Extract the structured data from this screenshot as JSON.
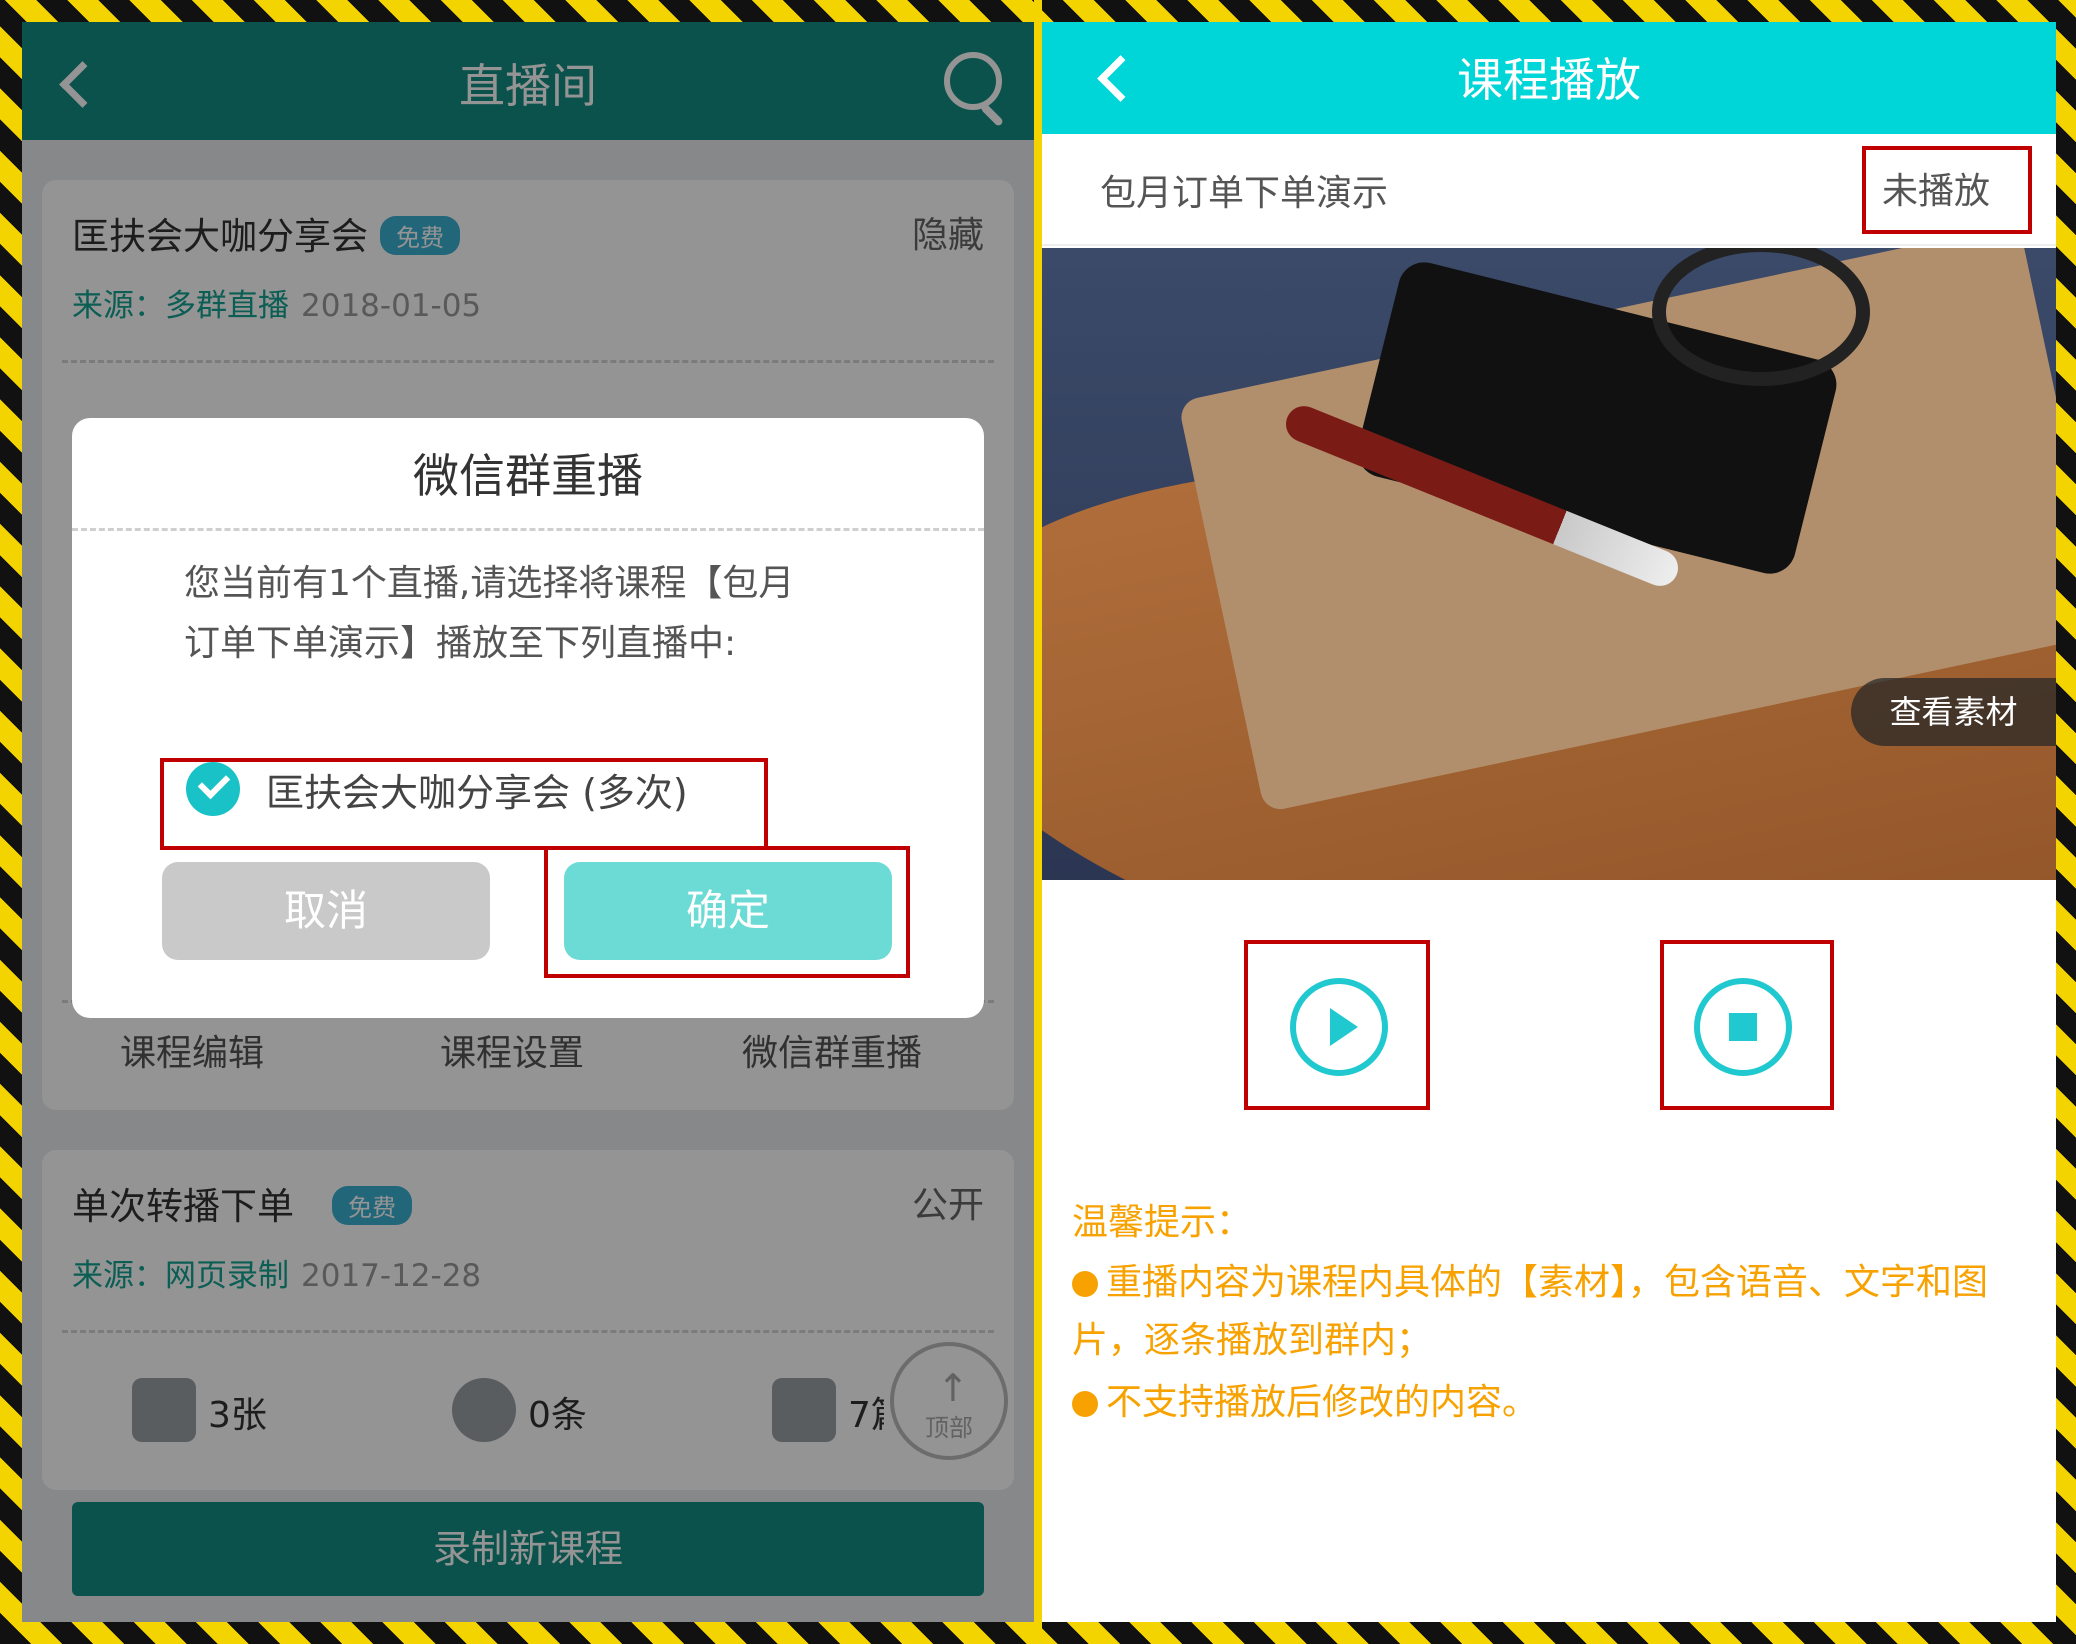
{
  "left": {
    "header": {
      "title": "直播间"
    },
    "card1": {
      "title": "匡扶会大咖分享会",
      "badge": "免费",
      "status": "隐藏",
      "source": "来源：多群直播",
      "date": "2018-01-05",
      "actions": [
        "课程编辑",
        "课程设置",
        "微信群重播"
      ]
    },
    "card2": {
      "title": "单次转播下单",
      "badge": "免费",
      "status": "公开",
      "source": "来源：网页录制",
      "date": "2017-12-28",
      "stats": [
        "3张",
        "0条",
        "7篇"
      ]
    },
    "to_top": "顶部",
    "record_button": "录制新课程",
    "dialog": {
      "title": "微信群重播",
      "message": "您当前有1个直播,请选择将课程【包月订单下单演示】播放至下列直播中:",
      "option": "匡扶会大咖分享会 (多次)",
      "cancel": "取消",
      "confirm": "确定"
    }
  },
  "right": {
    "header": {
      "title": "课程播放"
    },
    "course_name": "包月订单下单演示",
    "play_status": "未播放",
    "view_material": "查看素材",
    "tips_title": "温馨提示：",
    "tip1": "重播内容为课程内具体的【素材】，包含语音、文字和图片，逐条播放到群内；",
    "tip2": "不支持播放后修改的内容。"
  },
  "colors": {
    "left_header": "#128e82",
    "right_header": "#00d5d8",
    "confirm_button": "#6ddbd5",
    "highlight_box": "#c00000",
    "tip_text": "#f7a200"
  },
  "icons": [
    "back-icon",
    "search-icon",
    "check-icon",
    "image-icon",
    "mic-icon",
    "article-icon",
    "arrow-up-icon",
    "play-icon",
    "stop-icon"
  ]
}
